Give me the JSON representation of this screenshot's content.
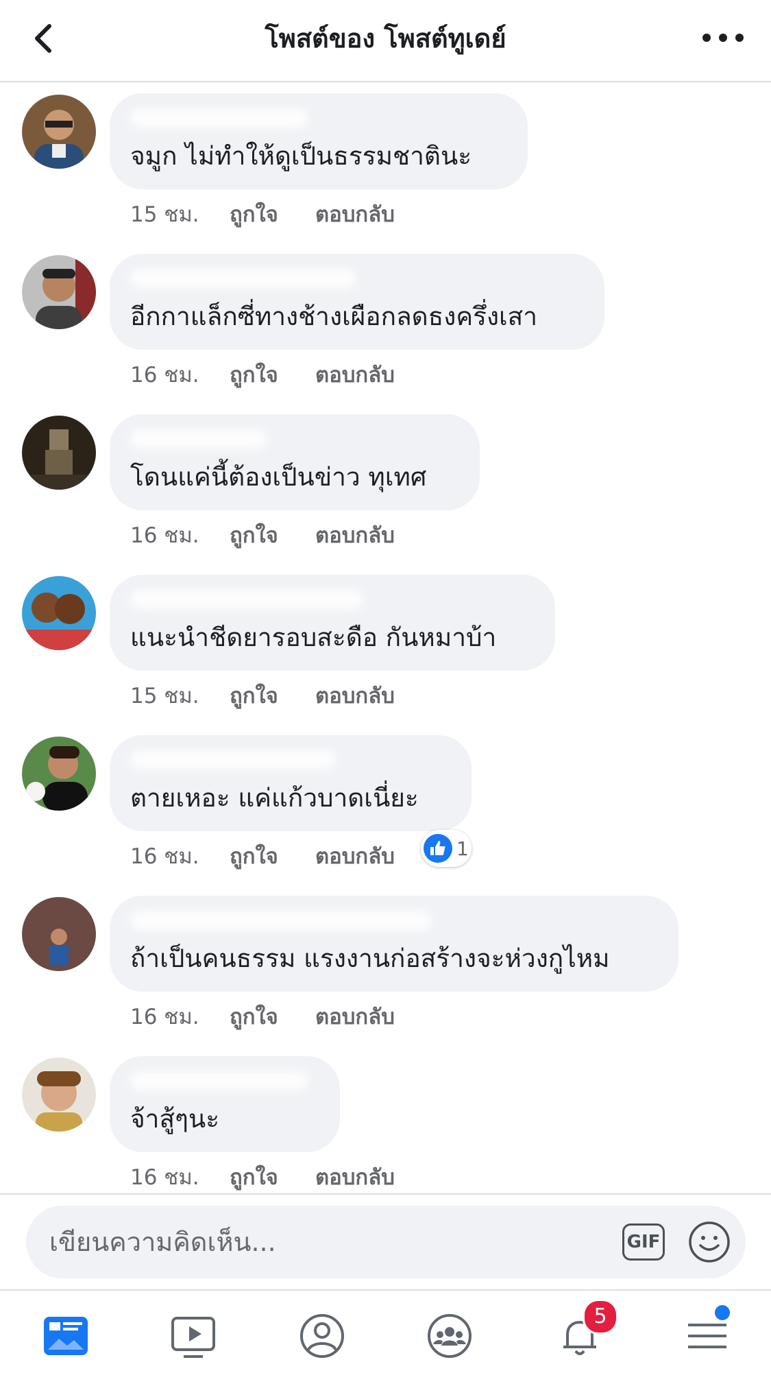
{
  "header": {
    "title": "โพสต์ของ โพสต์ทูเดย์"
  },
  "actions": {
    "like": "ถูกใจ",
    "reply": "ตอบกลับ"
  },
  "comments": [
    {
      "text": "จมูก ไม่ทำให้ดูเป็นธรรมชาตินะ",
      "time": "15 ชม."
    },
    {
      "text": "อีกกาแล็กซี่ทางช้างเผือกลดธงครึ่งเสา",
      "time": "16 ชม."
    },
    {
      "text": "โดนแค่นี้ต้องเป็นข่าว ทุเทศ",
      "time": "16 ชม."
    },
    {
      "text": "แนะนำชีดยารอบสะดือ กันหมาบ้า",
      "time": "15 ชม."
    },
    {
      "text": "ตายเหอะ แค่แก้วบาดเนี่ยะ",
      "time": "16 ชม.",
      "reaction_count": "1"
    },
    {
      "text": "ถ้าเป็นคนธรรม แรงงานก่อสร้างจะห่วงกูไหม",
      "time": "16 ชม."
    },
    {
      "text": "จ้าสู้ๆนะ",
      "time": "16 ชม."
    }
  ],
  "composer": {
    "placeholder": "เขียนความคิดเห็น...",
    "gif_label": "GIF"
  },
  "tabbar": {
    "notifications_badge": "5"
  },
  "colors": {
    "accent": "#1877f2",
    "badge": "#e41e3f",
    "bubble": "#f0f2f5",
    "meta": "#65676b"
  }
}
